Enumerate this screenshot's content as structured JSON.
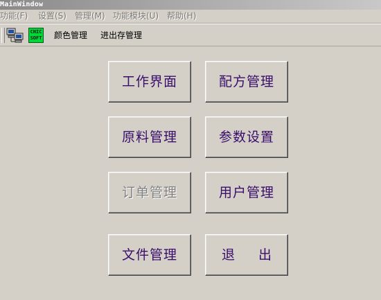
{
  "window": {
    "title": "MainWindow"
  },
  "menubar": {
    "items": [
      {
        "label": "功能(F)"
      },
      {
        "label": "设置(S)"
      },
      {
        "label": "管理(M)"
      },
      {
        "label": "功能模块(U)"
      },
      {
        "label": "帮助(H)"
      }
    ]
  },
  "toolbar": {
    "icons": [
      {
        "name": "network-computer-icon"
      },
      {
        "name": "chic-soft-logo-icon",
        "text": "CHIC SOFT"
      }
    ],
    "links": [
      {
        "label": "颜色管理"
      },
      {
        "label": "进出存管理"
      }
    ]
  },
  "main": {
    "buttons": [
      {
        "label": "工作界面",
        "enabled": true
      },
      {
        "label": "配方管理",
        "enabled": true
      },
      {
        "label": "原料管理",
        "enabled": true
      },
      {
        "label": "参数设置",
        "enabled": true
      },
      {
        "label": "订单管理",
        "enabled": false
      },
      {
        "label": "用户管理",
        "enabled": true
      },
      {
        "label": "文件管理",
        "enabled": true
      },
      {
        "label": "退 出",
        "enabled": true
      }
    ]
  },
  "colors": {
    "background": "#d4d0c8",
    "button_text": "#3a0d6b",
    "disabled_text": "#808080"
  }
}
